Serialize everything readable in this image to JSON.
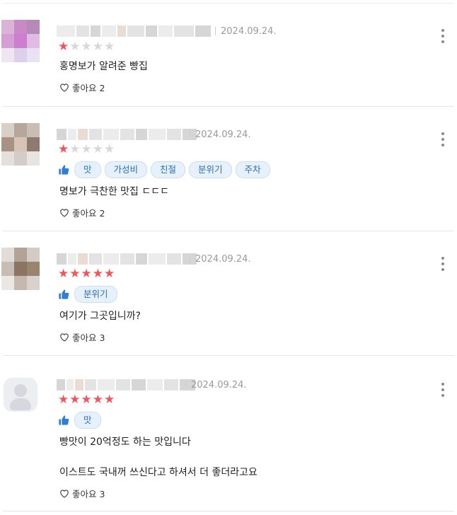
{
  "reviews": [
    {
      "date": "2024.09.24.",
      "rating": 1,
      "tags": [],
      "lines": [
        "홍명보가 알려준 빵집"
      ],
      "like_label": "좋아요 2"
    },
    {
      "date": "2024.09.24.",
      "rating": 1,
      "tags": [
        "맛",
        "가성비",
        "친절",
        "분위기",
        "주차"
      ],
      "lines": [
        "명보가 극찬한 맛집 ㄷㄷㄷ"
      ],
      "like_label": "좋아요 2"
    },
    {
      "date": "2024.09.24.",
      "rating": 5,
      "tags": [
        "분위기"
      ],
      "lines": [
        "여기가 그곳입니까?"
      ],
      "like_label": "좋아요 3"
    },
    {
      "date": "2024.09.24.",
      "rating": 5,
      "tags": [
        "맛"
      ],
      "lines": [
        "빵맛이 20억정도 하는 맛입니다",
        "이스트도 국내꺼 쓰신다고 하셔서 더 좋더라고요"
      ],
      "like_label": "좋아요 3"
    }
  ],
  "colors": {
    "star_on": "#f2545b",
    "star_off": "#d8d8d8",
    "tag_bg": "#e7f1fb",
    "tag_text": "#2c6fb7",
    "thumb": "#2f7fd8"
  },
  "icons": {
    "star": "star-icon",
    "thumb": "thumbs-up-icon",
    "heart": "heart-outline-icon",
    "menu": "more-vertical-icon",
    "avatar": "default-profile-icon"
  }
}
